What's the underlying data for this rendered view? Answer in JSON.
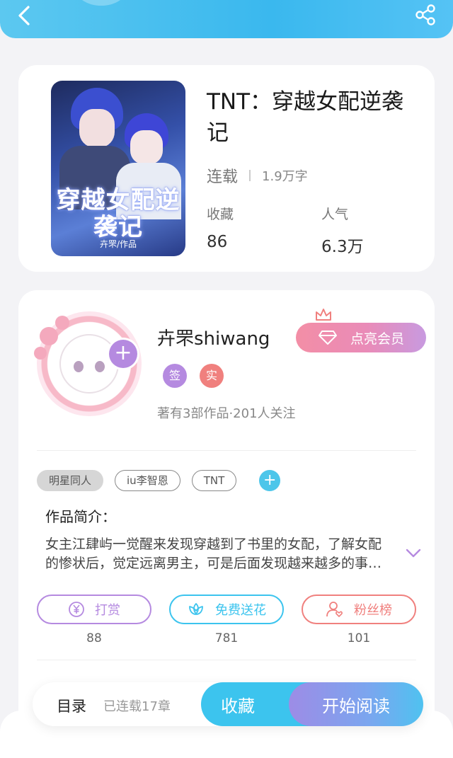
{
  "header": {
    "back_icon": "chevron-left-icon",
    "share_icon": "share-icon",
    "accent_color": "#3ab8ee"
  },
  "book": {
    "title": "TNT：穿越女配逆袭记",
    "cover_title": "穿越女配逆袭记",
    "cover_author": "卉罘/作品",
    "status": "连载",
    "word_count": "1.9万字",
    "stats": [
      {
        "label": "收藏",
        "value": "86"
      },
      {
        "label": "人气",
        "value": "6.3万"
      }
    ]
  },
  "author": {
    "name": "卉罘shiwang",
    "vip_label": "点亮会员",
    "badges": [
      {
        "text": "签",
        "color": "#b58ae0"
      },
      {
        "text": "实",
        "color": "#f0807e"
      }
    ],
    "summary": "著有3部作品·201人关注"
  },
  "tags": [
    "明星同人",
    "iu李智恩",
    "TNT"
  ],
  "intro": {
    "title": "作品简介：",
    "text": "女主江肆屿一觉醒来发现穿越到了书里的女配，了解女配的惨状后，觉定远离男主，可是后面发现越来越多的事情……"
  },
  "actions": [
    {
      "label": "打赏",
      "count": "88",
      "icon": "yen-icon",
      "color": "#b58ae0"
    },
    {
      "label": "免费送花",
      "count": "781",
      "icon": "flower-icon",
      "color": "#3cc4ee"
    },
    {
      "label": "粉丝榜",
      "count": "101",
      "icon": "fans-icon",
      "color": "#f0807e"
    }
  ],
  "bottom": {
    "toc": "目录",
    "chapters": "已连载17章",
    "favorite": "收藏",
    "read": "开始阅读"
  }
}
